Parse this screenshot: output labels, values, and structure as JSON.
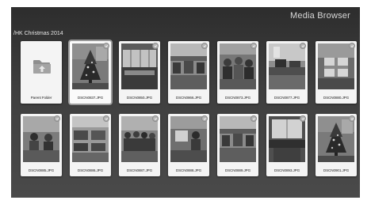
{
  "app": {
    "title": "Media Browser"
  },
  "breadcrumb": {
    "path": "/HK Christmas 2014"
  },
  "rows": [
    [
      {
        "type": "folder",
        "label": "Parent Folder",
        "icon": "folder-up-icon"
      },
      {
        "type": "photo",
        "label": "DSCN0837.JPG",
        "scene": "tree",
        "selected": true
      },
      {
        "type": "photo",
        "label": "DSCN0850.JPG",
        "scene": "office-window"
      },
      {
        "type": "photo",
        "label": "DSCN0866.JPG",
        "scene": "office-wide"
      },
      {
        "type": "photo",
        "label": "DSCN0873.JPG",
        "scene": "party"
      },
      {
        "type": "photo",
        "label": "DSCN0877.JPG",
        "scene": "desk-lamp"
      },
      {
        "type": "photo",
        "label": "DSCN0880.JPG",
        "scene": "gift"
      }
    ],
    [
      {
        "type": "photo",
        "label": "DSCN0885.JPG",
        "scene": "desk-workers"
      },
      {
        "type": "photo",
        "label": "DSCN0886.JPG",
        "scene": "office-desks"
      },
      {
        "type": "photo",
        "label": "DSCN0887.JPG",
        "scene": "people-group"
      },
      {
        "type": "photo",
        "label": "DSCN0888.JPG",
        "scene": "meeting"
      },
      {
        "type": "photo",
        "label": "DSCN0889.JPG",
        "scene": "office-wide"
      },
      {
        "type": "photo",
        "label": "DSCN0893.JPG",
        "scene": "window-desk"
      },
      {
        "type": "photo",
        "label": "DSCN0901.JPG",
        "scene": "tree"
      }
    ]
  ],
  "colors": {
    "background_top": "#2d2d2d",
    "background_bottom": "#4a4a4a",
    "tile": "#f4f4f4",
    "title_text": "#d8d8d8"
  }
}
